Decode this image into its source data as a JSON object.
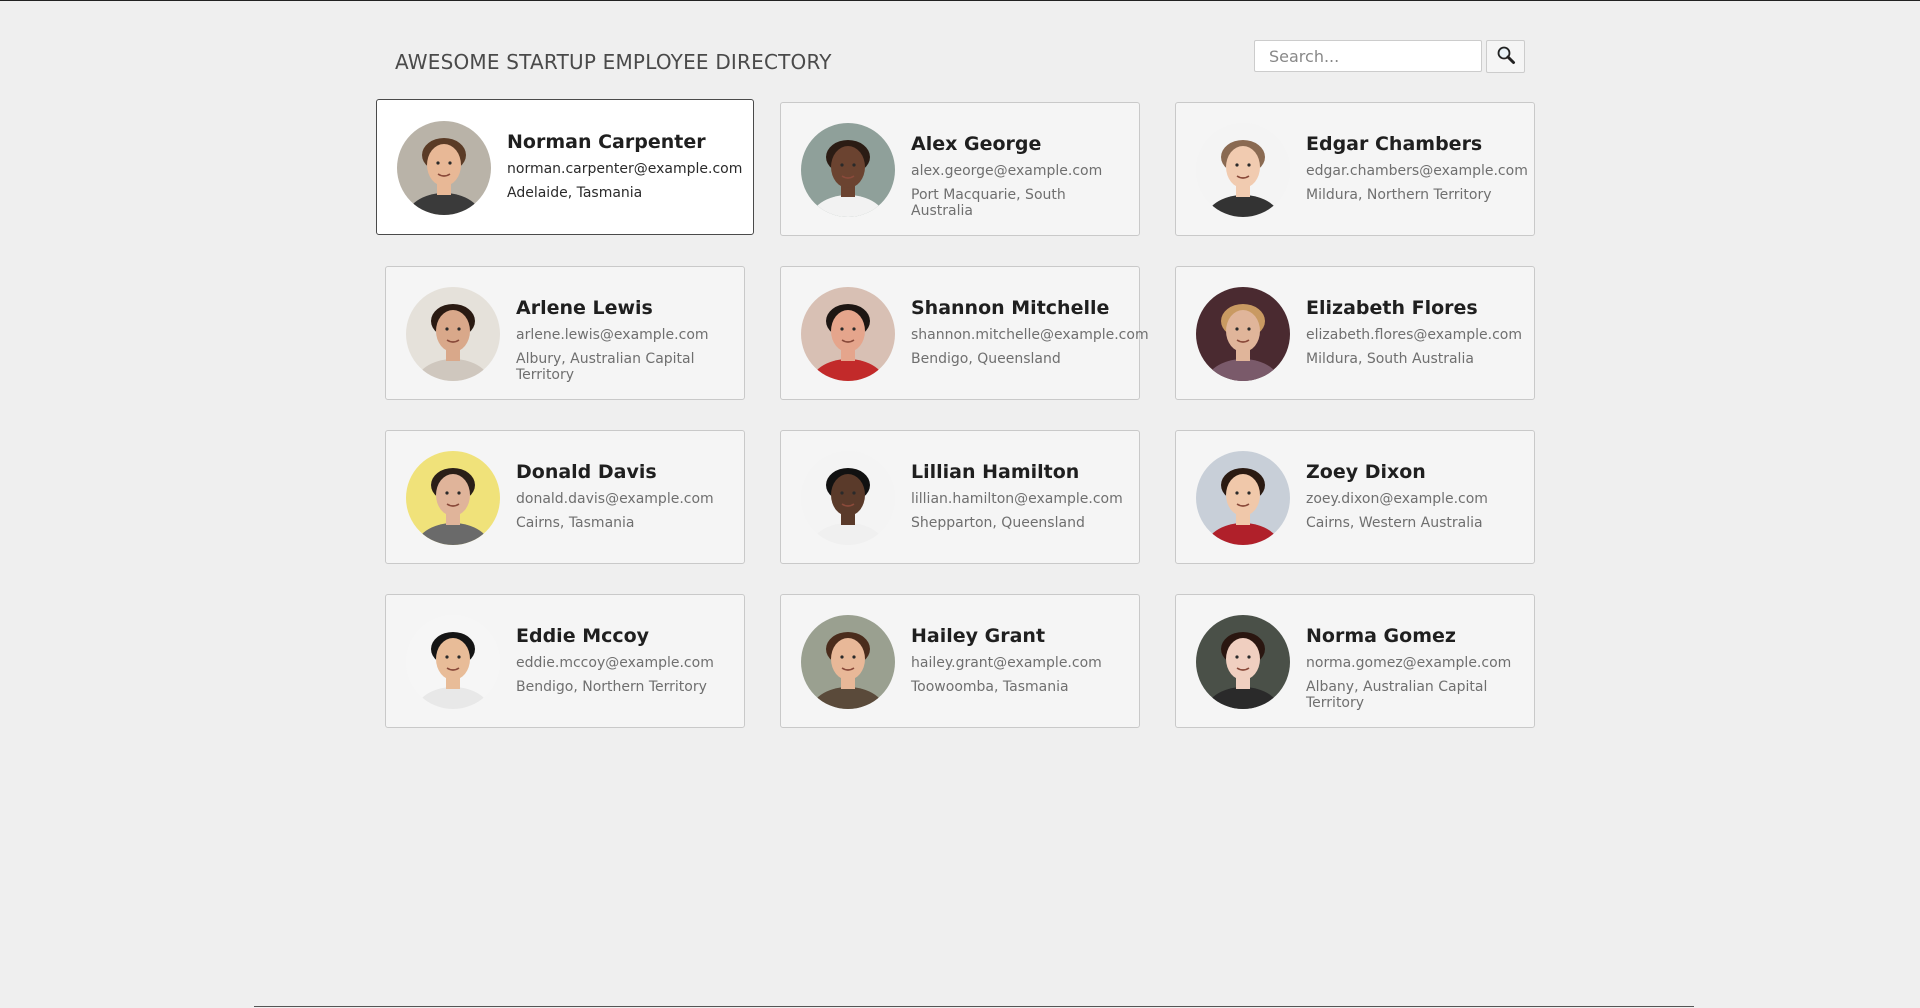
{
  "header": {
    "title": "AWESOME STARTUP EMPLOYEE DIRECTORY",
    "search": {
      "placeholder": "Search...",
      "value": ""
    },
    "search_icon": "magnifier-icon"
  },
  "employees": [
    {
      "name": "Norman Carpenter",
      "email": "norman.carpenter@example.com",
      "location": "Adelaide, Tasmania",
      "selected": true,
      "skin": "#e8b896",
      "hair": "#5a3b26",
      "bg": "#b9b3a8",
      "shirt": "#3a3a3a"
    },
    {
      "name": "Alex George",
      "email": "alex.george@example.com",
      "location": "Port Macquarie, South Australia",
      "selected": false,
      "skin": "#6b4330",
      "hair": "#2b1c14",
      "bg": "#8fa09a",
      "shirt": "#f2f2f2"
    },
    {
      "name": "Edgar Chambers",
      "email": "edgar.chambers@example.com",
      "location": "Mildura, Northern Territory",
      "selected": false,
      "skin": "#f1cbb0",
      "hair": "#8a6a52",
      "bg": "#f4f4f4",
      "shirt": "#333333"
    },
    {
      "name": "Arlene Lewis",
      "email": "arlene.lewis@example.com",
      "location": "Albury, Australian Capital Territory",
      "selected": false,
      "skin": "#d9a88a",
      "hair": "#2a1a12",
      "bg": "#e5e1da",
      "shirt": "#cfc7be"
    },
    {
      "name": "Shannon Mitchelle",
      "email": "shannon.mitchelle@example.com",
      "location": "Bendigo, Queensland",
      "selected": false,
      "skin": "#e5a58c",
      "hair": "#1d1613",
      "bg": "#d8c0b4",
      "shirt": "#c22a2a"
    },
    {
      "name": "Elizabeth Flores",
      "email": "elizabeth.flores@example.com",
      "location": "Mildura, South Australia",
      "selected": false,
      "skin": "#e0b59a",
      "hair": "#c99a62",
      "bg": "#4a2a30",
      "shirt": "#7a5a6a"
    },
    {
      "name": "Donald Davis",
      "email": "donald.davis@example.com",
      "location": "Cairns, Tasmania",
      "selected": false,
      "skin": "#e0b49a",
      "hair": "#2a1f18",
      "bg": "#f0e27a",
      "shirt": "#6a6a6a"
    },
    {
      "name": "Lillian Hamilton",
      "email": "lillian.hamilton@example.com",
      "location": "Shepparton, Queensland",
      "selected": false,
      "skin": "#5a3a2a",
      "hair": "#111111",
      "bg": "#f4f4f4",
      "shirt": "#f0f0f0"
    },
    {
      "name": "Zoey Dixon",
      "email": "zoey.dixon@example.com",
      "location": "Cairns, Western Australia",
      "selected": false,
      "skin": "#f0c8aa",
      "hair": "#2a1a12",
      "bg": "#c8cfd8",
      "shirt": "#b0202a"
    },
    {
      "name": "Eddie Mccoy",
      "email": "eddie.mccoy@example.com",
      "location": "Bendigo, Northern Territory",
      "selected": false,
      "skin": "#e8bc98",
      "hair": "#151515",
      "bg": "#f6f6f6",
      "shirt": "#e8e8e8"
    },
    {
      "name": "Hailey Grant",
      "email": "hailey.grant@example.com",
      "location": "Toowoomba, Tasmania",
      "selected": false,
      "skin": "#e8b898",
      "hair": "#4a2c1c",
      "bg": "#9aa090",
      "shirt": "#5a4a3a"
    },
    {
      "name": "Norma Gomez",
      "email": "norma.gomez@example.com",
      "location": "Albany, Australian Capital Territory",
      "selected": false,
      "skin": "#f0cfc0",
      "hair": "#2a1610",
      "bg": "#4a5048",
      "shirt": "#2a2a2a"
    }
  ]
}
